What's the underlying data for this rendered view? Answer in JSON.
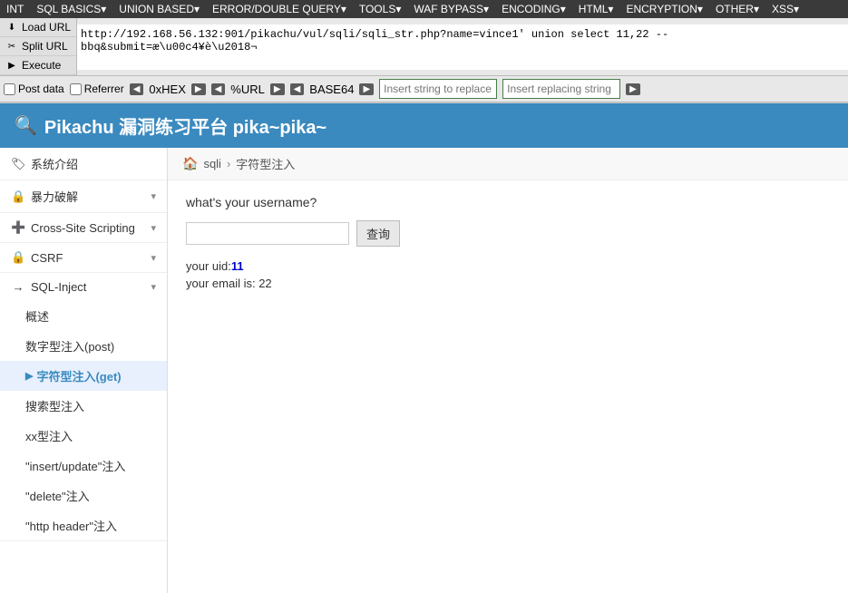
{
  "nav": {
    "items": [
      "INT",
      "SQL BASICS▾",
      "UNION BASED▾",
      "ERROR/DOUBLE QUERY▾",
      "TOOLS▾",
      "WAF BYPASS▾",
      "ENCODING▾",
      "HTML▾",
      "ENCRYPTION▾",
      "OTHER▾",
      "XSS▾"
    ]
  },
  "left_buttons": [
    {
      "id": "load-url",
      "label": "Load URL",
      "icon": "⬇"
    },
    {
      "id": "split-url",
      "label": "Split URL",
      "icon": "✂"
    },
    {
      "id": "execute",
      "label": "Execute",
      "icon": "▶"
    }
  ],
  "url_value": "http://192.168.56.132:901/pikachu/vul/sqli/sqli_str.php?name=vince1' union select 11,22 -- bbq&submit=æ\\u00c4¥è\\u2018¬",
  "options_bar": {
    "post_data": {
      "label": "Post data",
      "checked": false
    },
    "referrer": {
      "label": "Referrer",
      "checked": false
    },
    "hex_label": "0xHEX",
    "url_label": "%URL",
    "base64_label": "BASE64",
    "insert_string_placeholder": "Insert string to replace",
    "insert_replacing_placeholder": "Insert replacing string"
  },
  "app_header": {
    "title": "Pikachu 漏洞练习平台 pika~pika~",
    "icon": "🔍"
  },
  "breadcrumb": {
    "home_icon": "🏠",
    "items": [
      "sqli",
      "字符型注入"
    ]
  },
  "sidebar": {
    "sections": [
      {
        "items": [
          {
            "label": "系统介绍",
            "icon": "🏷",
            "type": "top",
            "expanded": false
          }
        ]
      },
      {
        "items": [
          {
            "label": "暴力破解",
            "icon": "🔒",
            "type": "top",
            "expanded": false
          }
        ]
      },
      {
        "items": [
          {
            "label": "Cross-Site Scripting",
            "icon": "➕",
            "type": "top",
            "expanded": false
          }
        ]
      },
      {
        "items": [
          {
            "label": "CSRF",
            "icon": "🔒",
            "type": "top",
            "expanded": false
          }
        ]
      },
      {
        "type": "expanded-group",
        "header": {
          "label": "SQL-Inject",
          "icon": "→",
          "expanded": true
        },
        "children": [
          {
            "label": "概述",
            "active": false
          },
          {
            "label": "数字型注入(post)",
            "active": false
          },
          {
            "label": "字符型注入(get)",
            "active": true
          },
          {
            "label": "搜索型注入",
            "active": false
          },
          {
            "label": "xx型注入",
            "active": false
          },
          {
            "label": "\"insert/update\"注入",
            "active": false
          },
          {
            "label": "\"delete\"注入",
            "active": false
          },
          {
            "label": "\"http header\"注入",
            "active": false
          }
        ]
      }
    ]
  },
  "page": {
    "question_label": "what's your username?",
    "query_button": "查询",
    "username_placeholder": "",
    "result": {
      "uid_label": "your uid:",
      "uid_value": "11",
      "email_label": "your email is: ",
      "email_value": "22"
    }
  }
}
